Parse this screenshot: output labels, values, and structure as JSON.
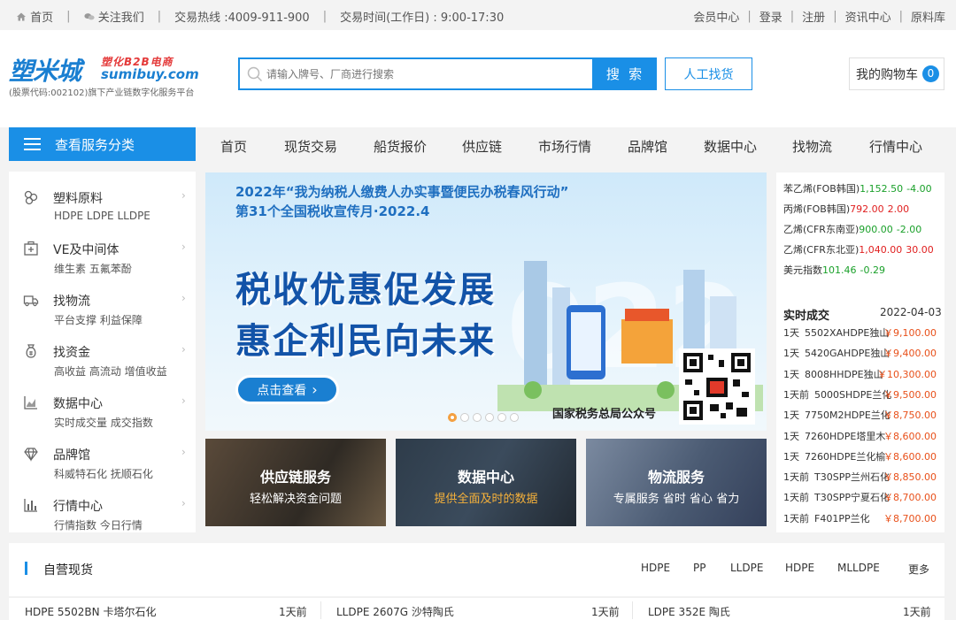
{
  "topbar": {
    "home": "首页",
    "follow": "关注我们",
    "hotline": "交易热线 :4009-911-900",
    "hours": "交易时间(工作日) : 9:00-17:30",
    "links": [
      "会员中心",
      "登录",
      "注册",
      "资讯中心",
      "原料库"
    ]
  },
  "logo": {
    "cn": "塑米城",
    "b2b": "塑化B2B电商",
    "en": "sumibuy.com",
    "sub": "(股票代码:002102)旗下产业链数字化服务平台"
  },
  "search": {
    "placeholder": "请输入牌号、厂商进行搜索",
    "button": "搜 索",
    "manual": "人工找货"
  },
  "cart": {
    "label": "我的购物车",
    "count": "0"
  },
  "nav": {
    "category": "查看服务分类",
    "items": [
      "首页",
      "现货交易",
      "船货报价",
      "供应链",
      "市场行情",
      "品牌馆",
      "数据中心",
      "找物流",
      "行情中心"
    ]
  },
  "categories": [
    {
      "title": "塑料原料",
      "sub": "HDPE LDPE LLDPE",
      "icon": "plastic-icon"
    },
    {
      "title": "VE及中间体",
      "sub": "维生素 五氟苯酚",
      "icon": "medical-box-icon"
    },
    {
      "title": "找物流",
      "sub": "平台支撑 利益保障",
      "icon": "truck-icon"
    },
    {
      "title": "找资金",
      "sub": "高收益 高流动 增值收益",
      "icon": "money-bag-icon"
    },
    {
      "title": "数据中心",
      "sub": "实时成交量 成交指数",
      "icon": "area-chart-icon"
    },
    {
      "title": "品牌馆",
      "sub": "科威特石化 抚顺石化",
      "icon": "diamond-icon"
    },
    {
      "title": "行情中心",
      "sub": "行情指数 今日行情",
      "icon": "bar-chart-icon"
    }
  ],
  "banner": {
    "line1": "2022年“我为纳税人缴费人办实事暨便民办税春风行动”",
    "line2": "第31个全国税收宣传月·2022.4",
    "headline1": "税收优惠促发展",
    "headline2": "惠企利民向未来",
    "view": "点击查看",
    "caption": "国家税务总局公众号",
    "active_dot": 0,
    "dot_count": 6
  },
  "tiles": [
    {
      "title": "供应链服务",
      "sub": "轻松解决资金问题"
    },
    {
      "title": "数据中心",
      "sub": "提供全面及时的数据"
    },
    {
      "title": "物流服务",
      "sub": "专属服务 省时 省心 省力"
    }
  ],
  "indices": [
    {
      "name": "苯乙烯(FOB韩国)",
      "value": "1,152.50",
      "change": "-4.00",
      "dir": "down"
    },
    {
      "name": "丙烯(FOB韩国)",
      "value": "792.00",
      "change": "2.00",
      "dir": "up"
    },
    {
      "name": "乙烯(CFR东南亚)",
      "value": "900.00",
      "change": "-2.00",
      "dir": "down"
    },
    {
      "name": "乙烯(CFR东北亚)",
      "value": "1,040.00",
      "change": "30.00",
      "dir": "up"
    },
    {
      "name": "美元指数",
      "value": "101.46",
      "change": "-0.29",
      "dir": "down"
    }
  ],
  "realtime": {
    "title": "实时成交",
    "date": "2022-04-03",
    "rows": [
      {
        "time": "1天",
        "item": "5502XAHDPE独山",
        "price": "￥9,100.00"
      },
      {
        "time": "1天",
        "item": "5420GAHDPE独山",
        "price": "￥9,400.00"
      },
      {
        "time": "1天",
        "item": "8008HHDPE独山",
        "price": "￥10,300.00"
      },
      {
        "time": "1天前",
        "item": "5000SHDPE兰化",
        "price": "￥9,500.00"
      },
      {
        "time": "1天",
        "item": "7750M2HDPE兰化",
        "price": "￥8,750.00"
      },
      {
        "time": "1天",
        "item": "7260HDPE塔里木",
        "price": "￥8,600.00"
      },
      {
        "time": "1天",
        "item": "7260HDPE兰化榆",
        "price": "￥8,600.00"
      },
      {
        "time": "1天前",
        "item": "T30SPP兰州石化",
        "price": "￥8,850.00"
      },
      {
        "time": "1天前",
        "item": "T30SPP宁夏石化",
        "price": "￥8,700.00"
      },
      {
        "time": "1天前",
        "item": "F401PP兰化",
        "price": "￥8,700.00"
      }
    ]
  },
  "selfop": {
    "title": "自营现货",
    "tabs": [
      "HDPE",
      "PP",
      "LLDPE",
      "HDPE",
      "MLLDPE",
      "更多"
    ],
    "rows": [
      {
        "name": "HDPE 5502BN 卡塔尔石化",
        "time": "1天前"
      },
      {
        "name": "LLDPE 2607G 沙特陶氏",
        "time": "1天前"
      },
      {
        "name": "LDPE 352E 陶氏",
        "time": "1天前"
      }
    ]
  }
}
